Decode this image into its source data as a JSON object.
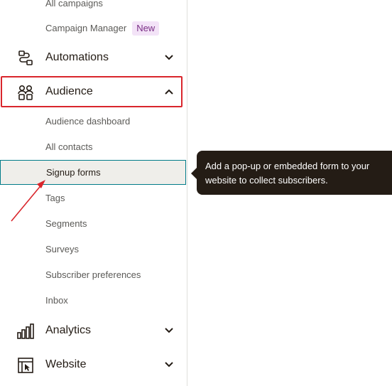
{
  "sidebar": {
    "items_top": [
      {
        "label": "All campaigns"
      },
      {
        "label": "Campaign Manager",
        "badge": "New"
      }
    ],
    "automations": {
      "label": "Automations",
      "icon": "automations-icon"
    },
    "audience": {
      "label": "Audience",
      "icon": "audience-icon",
      "expanded": true,
      "subitems": [
        {
          "label": "Audience dashboard"
        },
        {
          "label": "All contacts"
        },
        {
          "label": "Signup forms",
          "active": true
        },
        {
          "label": "Tags"
        },
        {
          "label": "Segments"
        },
        {
          "label": "Surveys"
        },
        {
          "label": "Subscriber preferences"
        },
        {
          "label": "Inbox"
        }
      ]
    },
    "analytics": {
      "label": "Analytics",
      "icon": "analytics-icon"
    },
    "website": {
      "label": "Website",
      "icon": "website-icon"
    }
  },
  "tooltip": {
    "line1": "Add a pop-up or embedded form to your",
    "line2": "website to collect subscribers."
  },
  "colors": {
    "highlight": "#d9262c",
    "active_border": "#007c89",
    "tooltip_bg": "#241c15",
    "badge_bg": "#f3e3f7"
  }
}
